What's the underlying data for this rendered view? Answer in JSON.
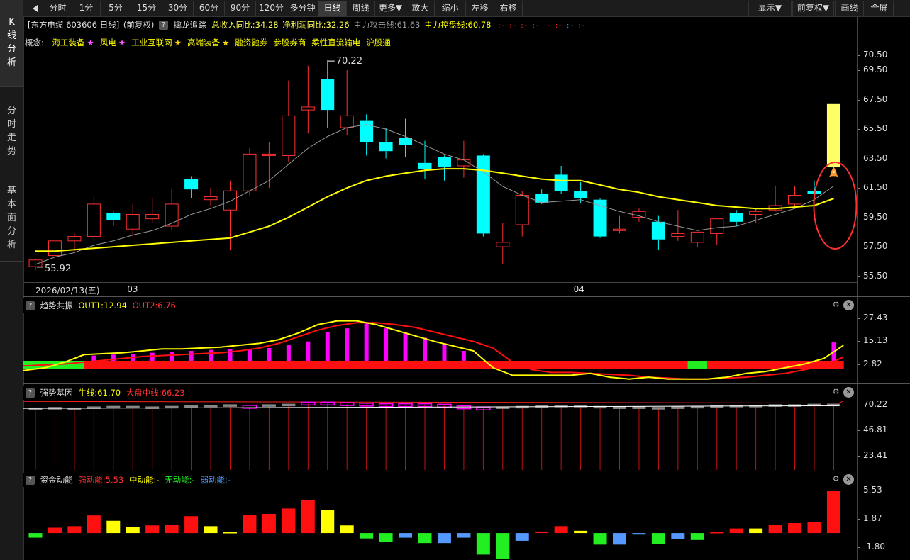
{
  "sidebar": {
    "tabs": [
      {
        "label": "K线分析",
        "chars": [
          "K",
          "线",
          "分",
          "析"
        ],
        "active": true
      },
      {
        "label": "分时走势",
        "chars": [
          "分",
          "时",
          "走",
          "势"
        ],
        "active": false
      },
      {
        "label": "基本面分析",
        "chars": [
          "基",
          "本",
          "面",
          "分",
          "析"
        ],
        "active": false
      }
    ]
  },
  "toolbar": {
    "back_icon": "back-arrow-icon",
    "items": [
      "分时",
      "1分",
      "5分",
      "15分",
      "30分",
      "60分",
      "90分",
      "120分",
      "多分钟",
      "日线",
      "周线",
      "更多▼",
      "放大",
      "缩小",
      "左移",
      "右移"
    ],
    "active": "日线",
    "right_items": [
      "显示▼",
      "前复权▼",
      "画线",
      "全屏"
    ]
  },
  "info": {
    "stock": "[东方电缆 603606 日线]",
    "adjust": "(前复权)",
    "indicator": "擒龙追踪",
    "revenue": "总收入同比:34.28",
    "profit": "净利润同比:32.26",
    "attack": "主力攻击线:61.63",
    "control": "主力控盘线:60.78"
  },
  "concepts": {
    "label": "概念:",
    "items": [
      {
        "name": "海工装备",
        "mark": "★",
        "mark_color": "#ff55ff"
      },
      {
        "name": "风电",
        "mark": "★",
        "mark_color": "#ff55ff"
      },
      {
        "name": "工业互联网",
        "mark": "★",
        "mark_color": "#ffd700"
      },
      {
        "name": "高端装备",
        "mark": "★",
        "mark_color": "#ffd700"
      },
      {
        "name": "融资融券",
        "mark": "",
        "mark_color": ""
      },
      {
        "name": "参股券商",
        "mark": "",
        "mark_color": ""
      },
      {
        "name": "柔性直流输电",
        "mark": "",
        "mark_color": ""
      },
      {
        "name": "沪股通",
        "mark": "",
        "mark_color": ""
      }
    ]
  },
  "chart_data": [
    {
      "type": "candlestick",
      "y_ticks": [
        "70.50",
        "69.50",
        "67.50",
        "65.50",
        "63.50",
        "61.50",
        "59.50",
        "57.50",
        "55.50"
      ],
      "ylim": [
        55.5,
        70.5
      ],
      "high_label": "70.22",
      "low_label": "55.92",
      "date_label": "2026/02/13(五)",
      "month_labels": [
        {
          "label": "03",
          "index": 5
        },
        {
          "label": "04",
          "index": 28
        }
      ],
      "candles": [
        {
          "o": 56.15,
          "c": 56.6,
          "h": 56.7,
          "l": 55.92
        },
        {
          "o": 56.9,
          "c": 57.9,
          "h": 58.2,
          "l": 56.6
        },
        {
          "o": 57.9,
          "c": 58.2,
          "h": 58.4,
          "l": 57.2
        },
        {
          "o": 58.2,
          "c": 60.4,
          "h": 61.0,
          "l": 57.8
        },
        {
          "o": 59.8,
          "c": 59.3,
          "h": 59.9,
          "l": 58.9
        },
        {
          "o": 58.7,
          "c": 59.7,
          "h": 60.4,
          "l": 58.2
        },
        {
          "o": 59.4,
          "c": 59.7,
          "h": 60.8,
          "l": 59.1
        },
        {
          "o": 58.9,
          "c": 60.4,
          "h": 61.4,
          "l": 58.6
        },
        {
          "o": 62.1,
          "c": 61.4,
          "h": 62.3,
          "l": 60.8
        },
        {
          "o": 60.7,
          "c": 60.9,
          "h": 61.5,
          "l": 60.3
        },
        {
          "o": 60.0,
          "c": 61.3,
          "h": 62.0,
          "l": 57.3
        },
        {
          "o": 61.3,
          "c": 63.8,
          "h": 64.2,
          "l": 61.0
        },
        {
          "o": 63.7,
          "c": 63.8,
          "h": 64.6,
          "l": 61.5
        },
        {
          "o": 63.7,
          "c": 66.4,
          "h": 68.8,
          "l": 63.3
        },
        {
          "o": 66.8,
          "c": 67.0,
          "h": 69.8,
          "l": 65.2
        },
        {
          "o": 68.9,
          "c": 66.8,
          "h": 70.22,
          "l": 65.6
        },
        {
          "o": 65.6,
          "c": 66.4,
          "h": 69.5,
          "l": 65.1
        },
        {
          "o": 66.1,
          "c": 64.6,
          "h": 66.5,
          "l": 63.7
        },
        {
          "o": 64.6,
          "c": 64.0,
          "h": 65.6,
          "l": 63.5
        },
        {
          "o": 64.9,
          "c": 64.4,
          "h": 66.2,
          "l": 63.6
        },
        {
          "o": 63.2,
          "c": 62.8,
          "h": 64.7,
          "l": 62.1
        },
        {
          "o": 63.6,
          "c": 62.9,
          "h": 63.7,
          "l": 62.0
        },
        {
          "o": 63.0,
          "c": 63.4,
          "h": 64.7,
          "l": 62.2
        },
        {
          "o": 63.7,
          "c": 58.4,
          "h": 63.8,
          "l": 58.2
        },
        {
          "o": 57.5,
          "c": 57.8,
          "h": 59.1,
          "l": 56.3
        },
        {
          "o": 59.0,
          "c": 61.0,
          "h": 61.3,
          "l": 58.2
        },
        {
          "o": 61.1,
          "c": 60.5,
          "h": 61.4,
          "l": 60.4
        },
        {
          "o": 62.4,
          "c": 61.3,
          "h": 63.0,
          "l": 61.1
        },
        {
          "o": 61.3,
          "c": 60.8,
          "h": 61.9,
          "l": 60.5
        },
        {
          "o": 60.7,
          "c": 58.2,
          "h": 60.8,
          "l": 58.1
        },
        {
          "o": 58.6,
          "c": 58.7,
          "h": 59.6,
          "l": 58.4
        },
        {
          "o": 59.5,
          "c": 59.9,
          "h": 60.1,
          "l": 59.2
        },
        {
          "o": 59.2,
          "c": 58.0,
          "h": 59.6,
          "l": 57.3
        },
        {
          "o": 58.2,
          "c": 58.4,
          "h": 60.0,
          "l": 57.9
        },
        {
          "o": 57.8,
          "c": 58.5,
          "h": 58.5,
          "l": 57.5
        },
        {
          "o": 58.4,
          "c": 59.4,
          "h": 59.4,
          "l": 57.6
        },
        {
          "o": 59.8,
          "c": 59.2,
          "h": 60.0,
          "l": 58.9
        },
        {
          "o": 59.7,
          "c": 59.9,
          "h": 60.1,
          "l": 59.1
        },
        {
          "o": 60.0,
          "c": 60.3,
          "h": 61.6,
          "l": 59.9
        },
        {
          "o": 60.4,
          "c": 61.0,
          "h": 61.6,
          "l": 60.1
        },
        {
          "o": 61.3,
          "c": 61.1,
          "h": 62.0,
          "l": 60.7
        },
        {
          "o": 62.9,
          "c": 67.2,
          "h": 67.2,
          "l": 62.9
        }
      ],
      "ma_fast": [
        56.3,
        56.8,
        57.1,
        57.6,
        57.9,
        58.3,
        58.6,
        59.1,
        59.7,
        60.1,
        60.6,
        61.3,
        62.0,
        63.1,
        64.2,
        65.0,
        65.6,
        65.8,
        65.5,
        65.0,
        64.4,
        63.8,
        63.4,
        62.6,
        61.6,
        61.0,
        60.5,
        60.6,
        60.7,
        60.3,
        59.9,
        59.6,
        59.2,
        58.9,
        58.6,
        58.8,
        58.9,
        59.3,
        59.7,
        60.1,
        60.7,
        61.63
      ],
      "ma_slow": [
        57.2,
        57.2,
        57.3,
        57.4,
        57.5,
        57.6,
        57.7,
        57.8,
        57.9,
        58.0,
        58.1,
        58.5,
        58.9,
        59.5,
        60.2,
        60.9,
        61.5,
        62.0,
        62.3,
        62.5,
        62.7,
        62.8,
        62.8,
        62.7,
        62.5,
        62.3,
        62.1,
        62.0,
        62.0,
        61.7,
        61.4,
        61.2,
        60.9,
        60.7,
        60.5,
        60.3,
        60.2,
        60.1,
        60.1,
        60.2,
        60.3,
        60.78
      ],
      "signal_icon": "rocket-icon"
    },
    {
      "type": "bar",
      "title": "趋势共振",
      "out1_label": "OUT1:12.94",
      "out2_label": "OUT2:6.76",
      "y_ticks": [
        "27.43",
        "15.13",
        "2.82"
      ],
      "ylim": [
        -7,
        30
      ],
      "bars": [
        0,
        0,
        0,
        7.5,
        8,
        8.5,
        9,
        9.5,
        10,
        10.5,
        11,
        11,
        11.5,
        13,
        15,
        20,
        22,
        25,
        22,
        20,
        17,
        14,
        10,
        0,
        0,
        0,
        0,
        0,
        0,
        0,
        0,
        0,
        0,
        0,
        0,
        0,
        0,
        0,
        0,
        0,
        0,
        14.5
      ],
      "band_color": [
        "green",
        "green",
        "green",
        "red",
        "red",
        "red",
        "red",
        "red",
        "red",
        "red",
        "red",
        "red",
        "red",
        "red",
        "red",
        "red",
        "red",
        "red",
        "red",
        "red",
        "red",
        "red",
        "red",
        "red",
        "red",
        "red",
        "red",
        "red",
        "red",
        "red",
        "red",
        "red",
        "red",
        "red",
        "green",
        "red",
        "red",
        "red",
        "red",
        "red",
        "red",
        "red"
      ],
      "out1": [
        -0.5,
        1,
        4,
        8,
        8.5,
        9,
        10,
        11,
        11,
        11.5,
        12,
        13,
        14,
        16,
        19.5,
        24,
        26,
        26,
        24,
        21,
        18,
        15,
        12.5,
        10,
        1,
        -3,
        -3,
        -3,
        -3,
        -2,
        -4,
        -5,
        -4,
        -5,
        -5,
        -5,
        -4,
        -2,
        -1,
        1,
        3,
        6,
        12.94
      ],
      "out2": [
        2,
        2.5,
        3,
        4,
        5,
        6,
        7,
        7.5,
        8,
        8.5,
        9,
        10,
        11.5,
        14,
        17.5,
        21,
        23.5,
        25,
        25,
        24,
        22.5,
        20,
        17.5,
        15,
        11.5,
        4,
        0,
        -1.5,
        -1.5,
        -2,
        -2.5,
        -3,
        -4,
        -4.5,
        -5,
        -5,
        -4.5,
        -4,
        -3,
        -2,
        0,
        2,
        6.76
      ]
    },
    {
      "type": "bar",
      "title": "强势基因",
      "bull_label": "牛线:61.70",
      "market_label": "大盘中线:66.23",
      "y_ticks": [
        "70.22",
        "46.81",
        "23.41"
      ],
      "ylim": [
        10,
        75
      ],
      "values": [
        66.5,
        67.0,
        66.5,
        67.5,
        68.0,
        68.0,
        67.5,
        68.0,
        68.5,
        69.0,
        69.5,
        68.5,
        69.5,
        70.0,
        71.5,
        71.5,
        71.0,
        70.5,
        70.0,
        70.0,
        70.0,
        69.5,
        68.0,
        67.0,
        67.5,
        68.0,
        68.5,
        69.0,
        69.0,
        68.0,
        67.5,
        67.5,
        67.0,
        67.5,
        68.0,
        68.5,
        69.0,
        69.0,
        69.5,
        69.5,
        70.0,
        70.0
      ],
      "dir": [
        "down",
        "down",
        "down",
        "down",
        "down",
        "down",
        "down",
        "down",
        "down",
        "down",
        "down",
        "up",
        "down",
        "down",
        "up",
        "up",
        "up",
        "up",
        "up",
        "up",
        "up",
        "up",
        "up",
        "up",
        "down",
        "down",
        "down",
        "down",
        "down",
        "down",
        "down",
        "down",
        "down",
        "down",
        "down",
        "down",
        "down",
        "down",
        "down",
        "down",
        "down",
        "down"
      ]
    },
    {
      "type": "bar",
      "title": "资金动能",
      "strong_label": "强动能:5.53",
      "mid_label": "中动能:-",
      "none_label": "无动能:-",
      "weak_label": "弱动能:-",
      "y_ticks": [
        "5.53",
        "1.87",
        "-1.80"
      ],
      "ylim": [
        -3.5,
        6
      ],
      "values": [
        -0.6,
        0.7,
        0.9,
        2.3,
        1.6,
        0.8,
        1.0,
        1.1,
        2.2,
        0.9,
        0.1,
        2.4,
        2.5,
        3.2,
        4.3,
        3.0,
        1.0,
        -0.7,
        -1.1,
        -0.6,
        -1.3,
        -1.3,
        -0.6,
        -2.8,
        -3.4,
        -1.0,
        0.2,
        0.9,
        0.3,
        -1.5,
        -1.5,
        -0.2,
        -1.4,
        -0.8,
        -0.9,
        0.1,
        0.6,
        0.6,
        1.1,
        1.3,
        1.4,
        5.53
      ],
      "colors": [
        "#22ee22",
        "#ff1010",
        "#ff1010",
        "#ff1010",
        "#ffff00",
        "#ffff00",
        "#ff1010",
        "#ff1010",
        "#ff1010",
        "#ffff00",
        "#ffff00",
        "#ff1010",
        "#ff1010",
        "#ff1010",
        "#ff1010",
        "#ffff00",
        "#ffff00",
        "#22ee22",
        "#22ee22",
        "#5599ff",
        "#22ee22",
        "#5599ff",
        "#5599ff",
        "#22ee22",
        "#22ee22",
        "#5599ff",
        "#ff1010",
        "#ff1010",
        "#ffff00",
        "#22ee22",
        "#5599ff",
        "#5599ff",
        "#22ee22",
        "#5599ff",
        "#22ee22",
        "#ff1010",
        "#ff1010",
        "#ffff00",
        "#ff1010",
        "#ff1010",
        "#ff1010",
        "#ff1010"
      ]
    }
  ],
  "colors": {
    "up": "#ff3030",
    "down": "#00ffff",
    "ma_fast": "#999999",
    "ma_slow": "#ffff00",
    "accent_yellow": "#ffff00",
    "circle": "#ff3030"
  }
}
